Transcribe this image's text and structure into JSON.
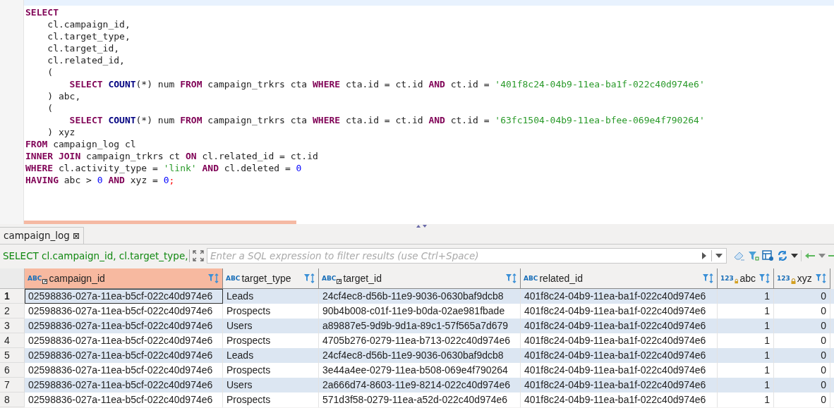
{
  "editor": {
    "lines": [
      [
        {
          "kind": "kw",
          "text": "SELECT"
        }
      ],
      [
        {
          "kind": "plain",
          "text": "    cl.campaign_id,"
        }
      ],
      [
        {
          "kind": "plain",
          "text": "    cl.target_type,"
        }
      ],
      [
        {
          "kind": "plain",
          "text": "    cl.target_id,"
        }
      ],
      [
        {
          "kind": "plain",
          "text": "    cl.related_id,"
        }
      ],
      [
        {
          "kind": "plain",
          "text": "    ("
        }
      ],
      [
        {
          "kind": "kw",
          "text": "        SELECT "
        },
        {
          "kind": "fn",
          "text": "COUNT"
        },
        {
          "kind": "plain",
          "text": "(*) num "
        },
        {
          "kind": "kw",
          "text": "FROM"
        },
        {
          "kind": "plain",
          "text": " campaign_trkrs cta "
        },
        {
          "kind": "kw",
          "text": "WHERE"
        },
        {
          "kind": "plain",
          "text": " cta.id = ct.id "
        },
        {
          "kind": "kw",
          "text": "AND"
        },
        {
          "kind": "plain",
          "text": " ct.id = "
        },
        {
          "kind": "str",
          "text": "'401f8c24-04b9-11ea-ba1f-022c40d974e6'"
        }
      ],
      [
        {
          "kind": "plain",
          "text": "    ) abc,"
        }
      ],
      [
        {
          "kind": "plain",
          "text": "    ("
        }
      ],
      [
        {
          "kind": "kw",
          "text": "        SELECT "
        },
        {
          "kind": "fn",
          "text": "COUNT"
        },
        {
          "kind": "plain",
          "text": "(*) num "
        },
        {
          "kind": "kw",
          "text": "FROM"
        },
        {
          "kind": "plain",
          "text": " campaign_trkrs cta "
        },
        {
          "kind": "kw",
          "text": "WHERE"
        },
        {
          "kind": "plain",
          "text": " cta.id = ct.id "
        },
        {
          "kind": "kw",
          "text": "AND"
        },
        {
          "kind": "plain",
          "text": " ct.id = "
        },
        {
          "kind": "str",
          "text": "'63fc1504-04b9-11ea-bfee-069e4f790264'"
        }
      ],
      [
        {
          "kind": "plain",
          "text": "    ) xyz"
        }
      ],
      [
        {
          "kind": "kw",
          "text": "FROM"
        },
        {
          "kind": "plain",
          "text": " campaign_log cl"
        }
      ],
      [
        {
          "kind": "kw",
          "text": "INNER JOIN"
        },
        {
          "kind": "plain",
          "text": " campaign_trkrs ct "
        },
        {
          "kind": "kw",
          "text": "ON"
        },
        {
          "kind": "plain",
          "text": " cl.related_id = ct.id"
        }
      ],
      [
        {
          "kind": "kw",
          "text": "WHERE"
        },
        {
          "kind": "plain",
          "text": " cl.activity_type = "
        },
        {
          "kind": "str",
          "text": "'link' "
        },
        {
          "kind": "kw",
          "text": "AND"
        },
        {
          "kind": "plain",
          "text": " cl.deleted = "
        },
        {
          "kind": "num",
          "text": "0"
        }
      ],
      [
        {
          "kind": "kw",
          "text": "HAVING"
        },
        {
          "kind": "plain",
          "text": " abc > "
        },
        {
          "kind": "num",
          "text": "0 "
        },
        {
          "kind": "kw",
          "text": "AND"
        },
        {
          "kind": "plain",
          "text": " xyz = "
        },
        {
          "kind": "num",
          "text": "0"
        },
        {
          "kind": "err",
          "text": ";"
        }
      ]
    ]
  },
  "results_tab": {
    "label": "campaign_log",
    "close": "⊠"
  },
  "filter_bar": {
    "query": "SELECT cl.campaign_id, cl.target_type,",
    "placeholder": "Enter a SQL expression to filter results (use Ctrl+Space)"
  },
  "table": {
    "columns": [
      {
        "name": "campaign_id",
        "type_icon": "ABC",
        "kind": "linked",
        "selected": true
      },
      {
        "name": "target_type",
        "type_icon": "ABC",
        "kind": "text",
        "selected": false
      },
      {
        "name": "target_id",
        "type_icon": "ABC",
        "kind": "linked",
        "selected": false
      },
      {
        "name": "related_id",
        "type_icon": "ABC",
        "kind": "text",
        "selected": false
      },
      {
        "name": "abc",
        "type_icon": "123",
        "kind": "number",
        "selected": false
      },
      {
        "name": "xyz",
        "type_icon": "123",
        "kind": "number",
        "selected": false
      }
    ],
    "rows": [
      {
        "number": "1",
        "selected": true,
        "cells": [
          "02598836-027a-11ea-b5cf-022c40d974e6",
          "Leads",
          "24cf4ec8-d56b-11e9-9036-0630baf9dcb8",
          "401f8c24-04b9-11ea-ba1f-022c40d974e6",
          "1",
          "0"
        ]
      },
      {
        "number": "2",
        "selected": false,
        "cells": [
          "02598836-027a-11ea-b5cf-022c40d974e6",
          "Prospects",
          "90b4b008-c01f-11e9-b0da-02ae981fbade",
          "401f8c24-04b9-11ea-ba1f-022c40d974e6",
          "1",
          "0"
        ]
      },
      {
        "number": "3",
        "selected": false,
        "cells": [
          "02598836-027a-11ea-b5cf-022c40d974e6",
          "Users",
          "a89887e5-9d9b-9d1a-89c1-57f565a7d679",
          "401f8c24-04b9-11ea-ba1f-022c40d974e6",
          "1",
          "0"
        ]
      },
      {
        "number": "4",
        "selected": false,
        "cells": [
          "02598836-027a-11ea-b5cf-022c40d974e6",
          "Prospects",
          "4705b276-0279-11ea-b713-022c40d974e6",
          "401f8c24-04b9-11ea-ba1f-022c40d974e6",
          "1",
          "0"
        ]
      },
      {
        "number": "5",
        "selected": false,
        "cells": [
          "02598836-027a-11ea-b5cf-022c40d974e6",
          "Leads",
          "24cf4ec8-d56b-11e9-9036-0630baf9dcb8",
          "401f8c24-04b9-11ea-ba1f-022c40d974e6",
          "1",
          "0"
        ]
      },
      {
        "number": "6",
        "selected": false,
        "cells": [
          "02598836-027a-11ea-b5cf-022c40d974e6",
          "Prospects",
          "3e44a4ee-0279-11ea-b508-069e4f790264",
          "401f8c24-04b9-11ea-ba1f-022c40d974e6",
          "1",
          "0"
        ]
      },
      {
        "number": "7",
        "selected": false,
        "cells": [
          "02598836-027a-11ea-b5cf-022c40d974e6",
          "Users",
          "2a666d74-8603-11e9-8214-022c40d974e6",
          "401f8c24-04b9-11ea-ba1f-022c40d974e6",
          "1",
          "0"
        ]
      },
      {
        "number": "8",
        "selected": false,
        "cells": [
          "02598836-027a-11ea-b5cf-022c40d974e6",
          "Prospects",
          "571d3f58-0279-11ea-a52d-022c40d974e6",
          "401f8c24-04b9-11ea-ba1f-022c40d974e6",
          "1",
          "0"
        ]
      }
    ]
  }
}
